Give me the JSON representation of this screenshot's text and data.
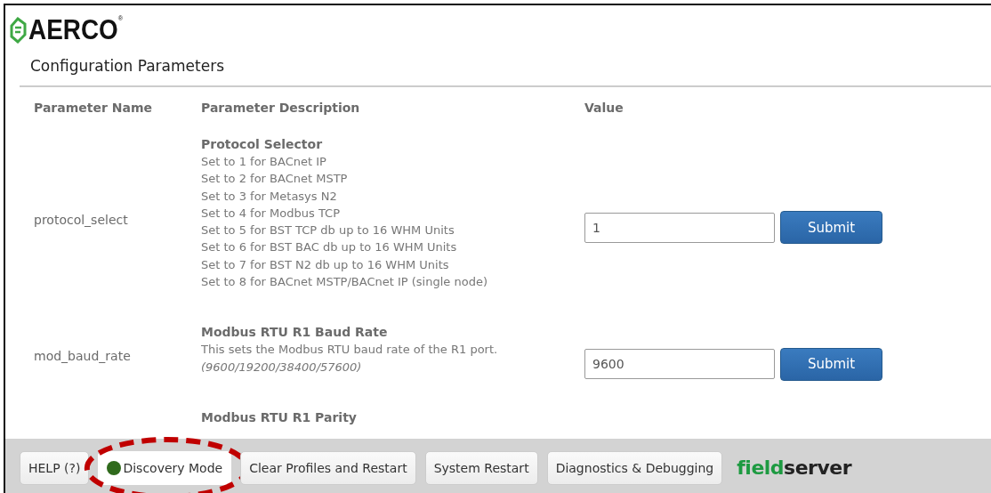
{
  "logo": "AERCO$^{®}$",
  "page_title": "Configuration Parameters",
  "table": {
    "columns": [
      "Parameter Name",
      "Parameter Description",
      "Value"
    ],
    "rows": [
      {
        "name": "protocol_select",
        "title": "Protocol Selector",
        "lines": [
          "Set to 1 for BACnet IP",
          "Set to 2 for BACnet MSTP",
          "Set to 3 for Metasys N2",
          "Set to 4 for Modbus TCP",
          "Set to 5 for BST TCP db up to 16 WHM Units",
          "Set to 6 for BST BAC db up to 16 WHM Units",
          "Set to 7 for BST N2 db up to 16 WHM Units",
          "Set to 8 for BACnet MSTP/BACnet IP (single node)"
        ],
        "value": "1",
        "button": "Submit"
      },
      {
        "name": "mod_baud_rate",
        "title": "Modbus RTU R1 Baud Rate",
        "lines": [
          "This sets the Modbus RTU baud rate of the R1 port.",
          "*(9600/19200/38400/57600)*"
        ],
        "value": "9600",
        "button": "Submit"
      },
      {
        "title": "Modbus RTU R1 Parity"
      }
    ]
  },
  "footer": {
    "buttons": [
      {
        "label": "HELP (?)",
        "highlighted": false
      },
      {
        "label": "Discovery Mode",
        "color": "#2f6a1c",
        "highlighted": true
      },
      {
        "label": "Clear Profiles and Restart",
        "highlighted": false
      },
      {
        "label": "System Restart",
        "highlighted": false
      },
      {
        "label": "Diagnostics & Debugging",
        "highlighted": false
      }
    ],
    "brand": [
      {
        "text": "field",
        "color": "#1d9a41"
      },
      {
        "text": "server",
        "color": "#222222"
      }
    ]
  }
}
